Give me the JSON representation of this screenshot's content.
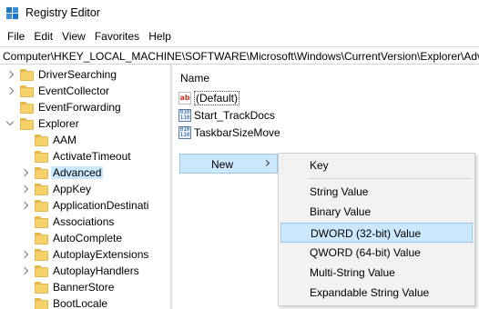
{
  "window": {
    "title": "Registry Editor"
  },
  "menu": [
    "File",
    "Edit",
    "View",
    "Favorites",
    "Help"
  ],
  "address": {
    "path": "Computer\\HKEY_LOCAL_MACHINE\\SOFTWARE\\Microsoft\\Windows\\CurrentVersion\\Explorer\\Advanced"
  },
  "tree": {
    "items": [
      {
        "label": "DriverSearching",
        "expander": "collapsed",
        "indent": 0
      },
      {
        "label": "EventCollector",
        "expander": "collapsed",
        "indent": 0
      },
      {
        "label": "EventForwarding",
        "expander": "none",
        "indent": 0
      },
      {
        "label": "Explorer",
        "expander": "expanded",
        "indent": 0
      },
      {
        "label": "AAM",
        "expander": "none",
        "indent": 1
      },
      {
        "label": "ActivateTimeout",
        "expander": "none",
        "indent": 1
      },
      {
        "label": "Advanced",
        "expander": "collapsed",
        "indent": 1,
        "selected": true
      },
      {
        "label": "AppKey",
        "expander": "collapsed",
        "indent": 1
      },
      {
        "label": "ApplicationDestinati",
        "expander": "collapsed",
        "indent": 1
      },
      {
        "label": "Associations",
        "expander": "none",
        "indent": 1
      },
      {
        "label": "AutoComplete",
        "expander": "none",
        "indent": 1
      },
      {
        "label": "AutoplayExtensions",
        "expander": "collapsed",
        "indent": 1
      },
      {
        "label": "AutoplayHandlers",
        "expander": "collapsed",
        "indent": 1
      },
      {
        "label": "BannerStore",
        "expander": "none",
        "indent": 1
      },
      {
        "label": "BootLocale",
        "expander": "none",
        "indent": 1
      }
    ]
  },
  "values": {
    "column_name": "Name",
    "items": [
      {
        "name": "(Default)",
        "icon": "string-value-icon",
        "icon_text": "ab"
      },
      {
        "name": "Start_TrackDocs",
        "icon": "binary-value-icon",
        "icon_text": "010\n110"
      },
      {
        "name": "TaskbarSizeMove",
        "icon": "binary-value-icon",
        "icon_text": "010\n110"
      }
    ]
  },
  "context_menu": {
    "new_label": "New",
    "submenu": [
      {
        "label": "Key"
      },
      {
        "separator": true
      },
      {
        "label": "String Value"
      },
      {
        "label": "Binary Value"
      },
      {
        "label": "DWORD (32-bit) Value",
        "highlighted": true
      },
      {
        "label": "QWORD (64-bit) Value"
      },
      {
        "label": "Multi-String Value"
      },
      {
        "label": "Expandable String Value"
      }
    ]
  },
  "colors": {
    "selection": "#cce8ff",
    "selection_border": "#9cc6ea",
    "folder": "#f7d26a",
    "app_icon": "#1e78c8"
  }
}
